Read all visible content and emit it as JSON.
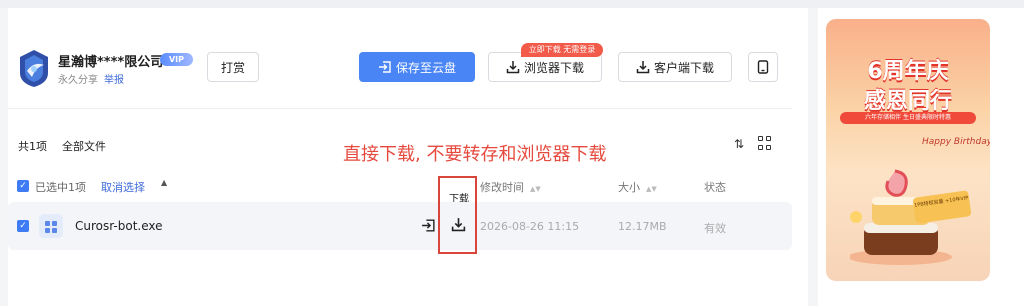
{
  "owner": {
    "name": "星瀚博****限公司",
    "vip": "VIP",
    "share_type": "永久分享",
    "report": "举报"
  },
  "toolbar": {
    "tip": "打赏",
    "save": "保存至云盘",
    "browser_download": "浏览器下载",
    "promo": "立即下载 无需登录",
    "client_download": "客户端下载"
  },
  "files_bar": {
    "count": "共1项",
    "all_files": "全部文件",
    "annotation": "直接下载, 不要转存和浏览器下载"
  },
  "table": {
    "selected": "已选中1项",
    "cancel_select": "取消选择",
    "tooltip": "下载",
    "columns": {
      "modified": "修改时间",
      "size": "大小",
      "status": "状态"
    },
    "rows": [
      {
        "name": "Curosr-bot.exe",
        "modified": "2026-08-26 11:15",
        "size": "12.17MB",
        "status": "有效"
      }
    ]
  },
  "banner": {
    "title_line1": "6周年庆",
    "title_line2": "感恩同行",
    "subtitle": "六年存储相伴 生日盛典限时特惠",
    "card_text": "1PB特权容量 +10年VIP",
    "birthday": "Happy Birthday",
    "colors": {
      "accent": "#e2342a",
      "card": "#f7c253"
    }
  },
  "colors": {
    "primary": "#4a85f6",
    "link": "#3f6bd8",
    "annotation": "#e64a3e"
  }
}
